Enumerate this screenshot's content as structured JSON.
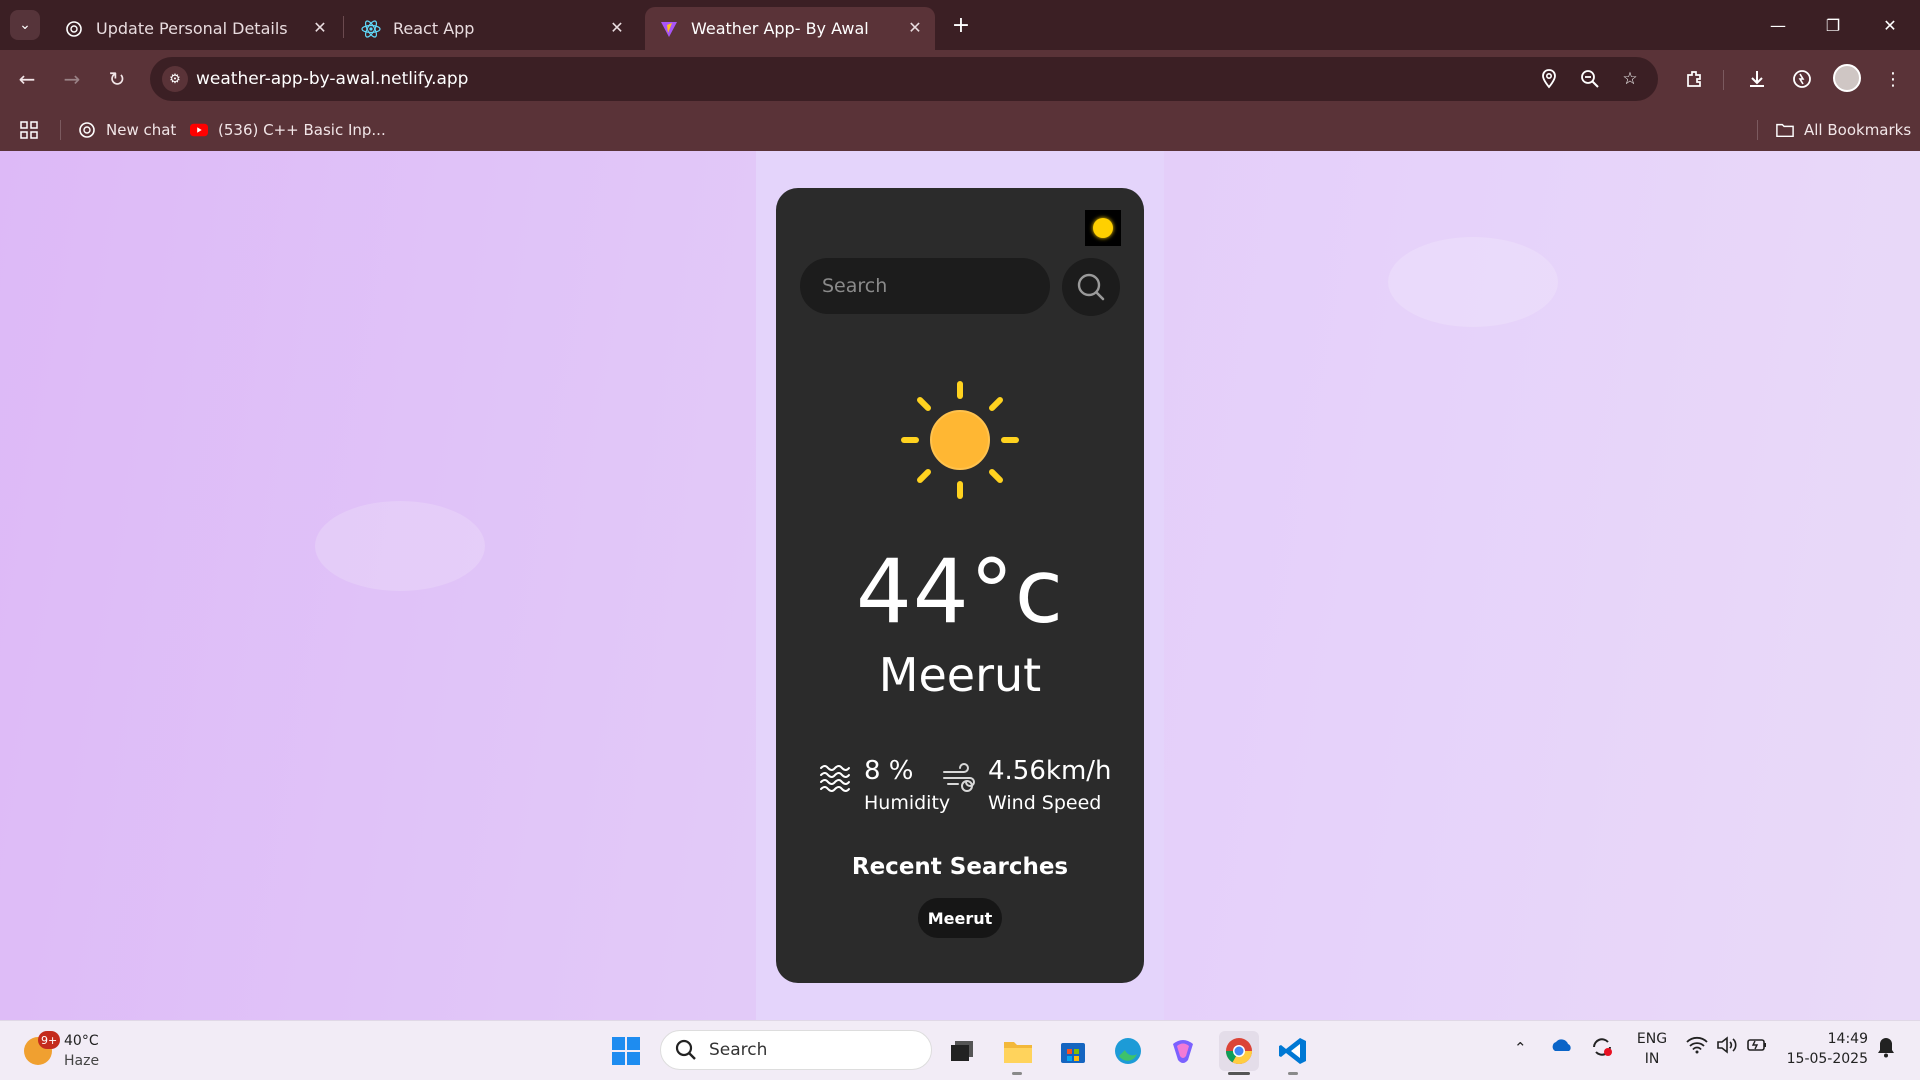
{
  "browser": {
    "tabs": [
      {
        "title": "Update Personal Details"
      },
      {
        "title": "React App"
      },
      {
        "title": "Weather App- By Awal"
      }
    ],
    "url": "weather-app-by-awal.netlify.app",
    "bookmarks": [
      {
        "label": "New chat"
      },
      {
        "label": "(536) C++ Basic Inp..."
      }
    ],
    "all_bookmarks_label": "All Bookmarks"
  },
  "app": {
    "search_placeholder": "Search",
    "temperature": "44°c",
    "city": "Meerut",
    "humidity_value": "8 %",
    "humidity_label": "Humidity",
    "wind_value": "4.56km/h",
    "wind_label": "Wind Speed",
    "recent_title": "Recent Searches",
    "recent_items": [
      "Meerut"
    ],
    "colors": {
      "card_bg": "#2b2b2b",
      "sun": "#ffb733",
      "sun_rays": "#ffd21f",
      "toggle_dot": "#ffd000"
    }
  },
  "taskbar": {
    "weather_temp": "40°C",
    "weather_desc": "Haze",
    "weather_badge": "9+",
    "search_label": "Search",
    "lang_line1": "ENG",
    "lang_line2": "IN",
    "time": "14:49",
    "date": "15-05-2025"
  }
}
